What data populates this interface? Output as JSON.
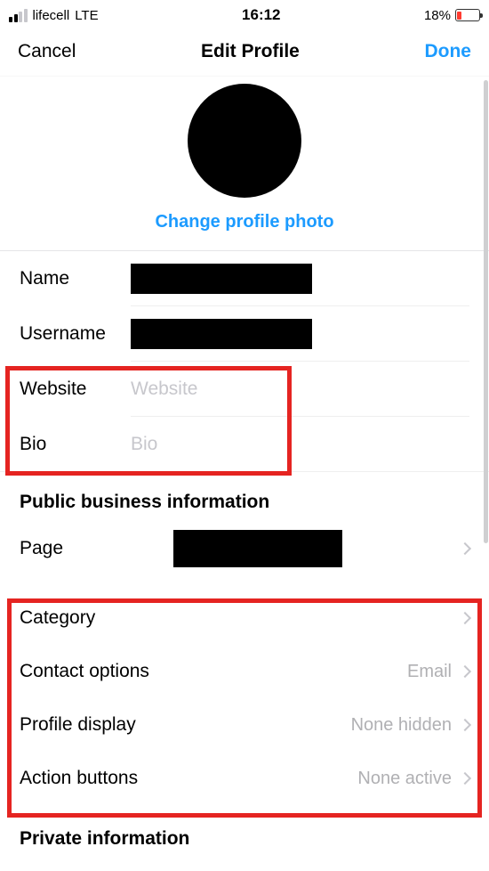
{
  "status_bar": {
    "carrier": "lifecell",
    "network": "LTE",
    "time": "16:12",
    "battery_pct": "18%"
  },
  "nav": {
    "cancel": "Cancel",
    "title": "Edit Profile",
    "done": "Done"
  },
  "profile": {
    "change_photo": "Change profile photo"
  },
  "fields": {
    "name_label": "Name",
    "username_label": "Username",
    "website_label": "Website",
    "website_placeholder": "Website",
    "bio_label": "Bio",
    "bio_placeholder": "Bio"
  },
  "business_section": {
    "header": "Public business information",
    "page_label": "Page",
    "category_label": "Category",
    "contact_label": "Contact options",
    "contact_value": "Email",
    "profile_display_label": "Profile display",
    "profile_display_value": "None hidden",
    "action_buttons_label": "Action buttons",
    "action_buttons_value": "None active"
  },
  "private_section": {
    "header": "Private information"
  }
}
